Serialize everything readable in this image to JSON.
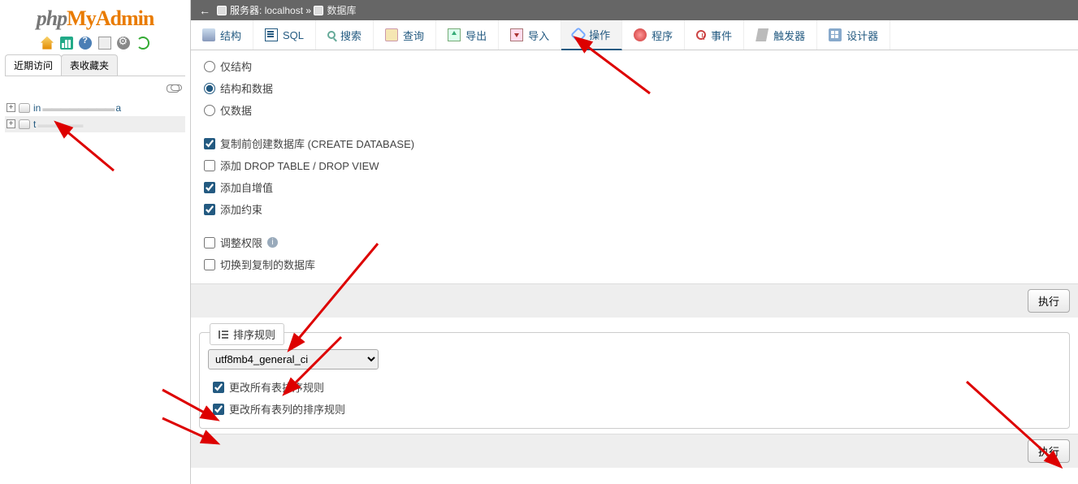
{
  "logo": {
    "part1": "php",
    "part2": "MyAdmin",
    "part3": ""
  },
  "sidebar": {
    "tabs": {
      "recent": "近期访问",
      "favorites": "表收藏夹"
    },
    "dbs": [
      {
        "name": "information_schema",
        "display": "in"
      },
      {
        "name": "t",
        "display": "t"
      }
    ]
  },
  "breadcrumb": {
    "server_label": "服务器:",
    "server": "localhost",
    "sep": "»",
    "db_label": "数据库"
  },
  "toptabs": [
    {
      "label": "结构",
      "icon": "struct"
    },
    {
      "label": "SQL",
      "icon": "sql"
    },
    {
      "label": "搜索",
      "icon": "search"
    },
    {
      "label": "查询",
      "icon": "query"
    },
    {
      "label": "导出",
      "icon": "export"
    },
    {
      "label": "导入",
      "icon": "import"
    },
    {
      "label": "操作",
      "icon": "ops",
      "active": true
    },
    {
      "label": "程序",
      "icon": "proc"
    },
    {
      "label": "事件",
      "icon": "event"
    },
    {
      "label": "触发器",
      "icon": "trig"
    },
    {
      "label": "设计器",
      "icon": "design"
    }
  ],
  "options": {
    "radios": {
      "only_structure": "仅结构",
      "structure_and_data": "结构和数据",
      "only_data": "仅数据",
      "selected": "structure_and_data"
    },
    "checks": {
      "create_db": {
        "label": "复制前创建数据库 (CREATE DATABASE)",
        "checked": true
      },
      "add_drop": {
        "label": "添加 DROP TABLE / DROP VIEW",
        "checked": false
      },
      "add_ai": {
        "label": "添加自增值",
        "checked": true
      },
      "add_constraints": {
        "label": "添加约束",
        "checked": true
      },
      "adjust_priv": {
        "label": "调整权限",
        "checked": false,
        "help": true
      },
      "switch_db": {
        "label": "切换到复制的数据库",
        "checked": false
      }
    },
    "exec": "执行"
  },
  "collation": {
    "legend": "排序规则",
    "value": "utf8mb4_general_ci",
    "change_tables": {
      "label": "更改所有表排序规则",
      "checked": true
    },
    "change_columns": {
      "label": "更改所有表列的排序规则",
      "checked": true
    },
    "exec": "执行"
  }
}
